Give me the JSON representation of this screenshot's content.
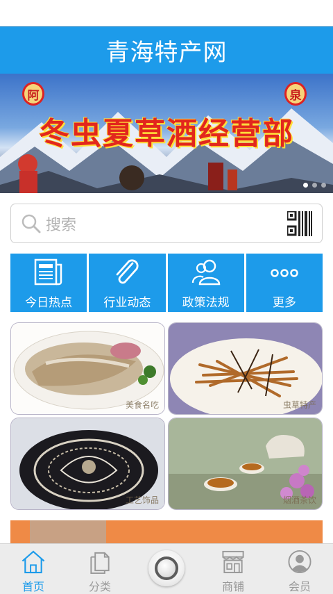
{
  "header": {
    "title": "青海特产网"
  },
  "banner": {
    "text": "冬虫夏草酒经营部",
    "seal_left": "阿",
    "seal_right": "泉",
    "slides": 3,
    "active_slide": 1
  },
  "search": {
    "placeholder": "搜索",
    "icon": "search-icon",
    "scan_icon": "qr-code-icon"
  },
  "menu": {
    "items": [
      {
        "label": "今日热点",
        "icon": "newspaper-icon"
      },
      {
        "label": "行业动态",
        "icon": "paperclip-icon"
      },
      {
        "label": "政策法规",
        "icon": "users-icon"
      },
      {
        "label": "更多",
        "icon": "more-dots-icon"
      }
    ]
  },
  "tiles": [
    {
      "caption": "美食名吃"
    },
    {
      "caption": "虫草特产"
    },
    {
      "caption": "工艺饰品"
    },
    {
      "caption": "烟酒茶饮"
    }
  ],
  "tabbar": {
    "items": [
      {
        "label": "首页",
        "icon": "home-icon",
        "active": true
      },
      {
        "label": "分类",
        "icon": "category-icon",
        "active": false
      },
      {
        "label": "商铺",
        "icon": "store-icon",
        "active": false
      },
      {
        "label": "会员",
        "icon": "member-icon",
        "active": false
      }
    ]
  },
  "colors": {
    "primary": "#1d9bea",
    "tab_inactive": "#999999",
    "strip": "#ef8a46"
  }
}
